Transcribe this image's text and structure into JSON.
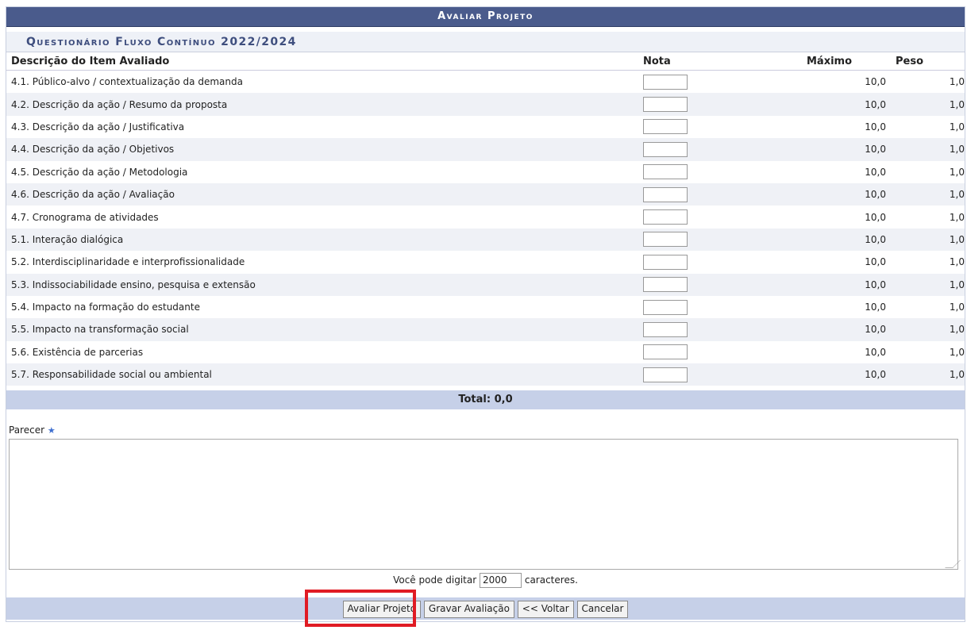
{
  "title": "Avaliar Projeto",
  "questionnaire_title": "Questionário Fluxo Contínuo 2022/2024",
  "columns": {
    "description": "Descrição do Item Avaliado",
    "nota": "Nota",
    "maximo": "Máximo",
    "peso": "Peso"
  },
  "items": [
    {
      "label": "4.1. Público-alvo / contextualização da demanda",
      "maximo": "10,0",
      "peso": "1,0"
    },
    {
      "label": "4.2. Descrição da ação / Resumo da proposta",
      "maximo": "10,0",
      "peso": "1,0"
    },
    {
      "label": "4.3. Descrição da ação / Justificativa",
      "maximo": "10,0",
      "peso": "1,0"
    },
    {
      "label": "4.4. Descrição da ação / Objetivos",
      "maximo": "10,0",
      "peso": "1,0"
    },
    {
      "label": "4.5. Descrição da ação / Metodologia",
      "maximo": "10,0",
      "peso": "1,0"
    },
    {
      "label": "4.6. Descrição da ação / Avaliação",
      "maximo": "10,0",
      "peso": "1,0"
    },
    {
      "label": "4.7. Cronograma de atividades",
      "maximo": "10,0",
      "peso": "1,0"
    },
    {
      "label": "5.1. Interação dialógica",
      "maximo": "10,0",
      "peso": "1,0"
    },
    {
      "label": "5.2. Interdisciplinaridade e interprofissionalidade",
      "maximo": "10,0",
      "peso": "1,0"
    },
    {
      "label": "5.3. Indissociabilidade ensino, pesquisa e extensão",
      "maximo": "10,0",
      "peso": "1,0"
    },
    {
      "label": "5.4. Impacto na formação do estudante",
      "maximo": "10,0",
      "peso": "1,0"
    },
    {
      "label": "5.5. Impacto na transformação social",
      "maximo": "10,0",
      "peso": "1,0"
    },
    {
      "label": "5.6. Existência de parcerias",
      "maximo": "10,0",
      "peso": "1,0"
    },
    {
      "label": "5.7. Responsabilidade social ou ambiental",
      "maximo": "10,0",
      "peso": "1,0"
    }
  ],
  "total": "Total: 0,0",
  "parecer_label": "Parecer",
  "required_mark": "★",
  "counter": {
    "before": "Você pode digitar",
    "value": "2000",
    "after": "caracteres."
  },
  "buttons": {
    "avaliar": "Avaliar Projeto",
    "gravar": "Gravar Avaliação",
    "voltar": "<< Voltar",
    "cancelar": "Cancelar"
  },
  "colors": {
    "header": "#4a5b8c",
    "row_alt": "#eff1f6",
    "bar": "#c6d0e8",
    "highlight": "#e01b24"
  }
}
